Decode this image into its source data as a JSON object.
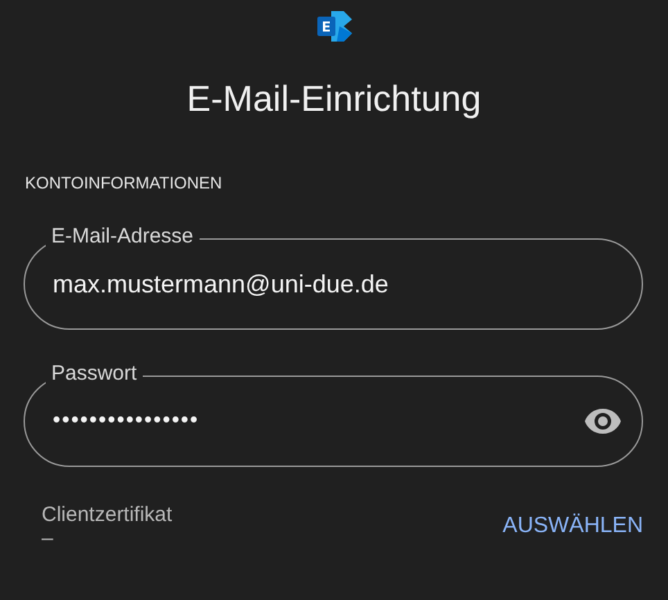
{
  "title": "E-Mail-Einrichtung",
  "section": "KONTOINFORMATIONEN",
  "fields": [
    {
      "label": "E-Mail-Adresse",
      "value": "max.mustermann@uni-due.de",
      "kind": "text"
    },
    {
      "label": "Passwort",
      "value": "••••••••••••••••",
      "kind": "password"
    }
  ],
  "certificate": {
    "label": "Clientzertifikat",
    "value": "–",
    "action": "AUSWÄHLEN"
  }
}
